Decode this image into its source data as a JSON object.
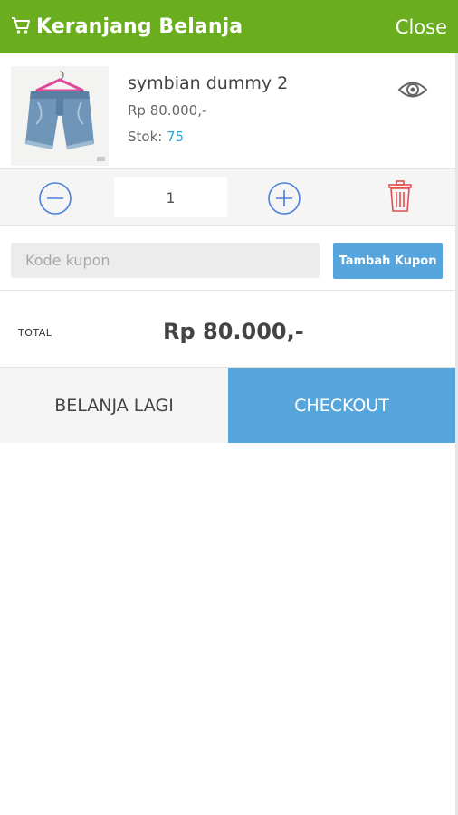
{
  "header": {
    "title": "Keranjang Belanja",
    "close_label": "Close",
    "color": "#6aad1e"
  },
  "cart": {
    "item": {
      "name": "symbian dummy 2",
      "price": "Rp 80.000,-",
      "stock_label": "Stok:",
      "stock_value": "75",
      "quantity": "1"
    }
  },
  "coupon": {
    "placeholder": "Kode kupon",
    "button_label": "Tambah Kupon"
  },
  "total": {
    "label": "TOTAL",
    "value": "Rp 80.000,-"
  },
  "actions": {
    "continue_label": "BELANJA LAGI",
    "checkout_label": "CHECKOUT",
    "accent_color": "#56a5dc"
  },
  "icons": [
    "cart-icon",
    "eye-icon",
    "minus-circle-icon",
    "plus-circle-icon",
    "trash-icon"
  ]
}
